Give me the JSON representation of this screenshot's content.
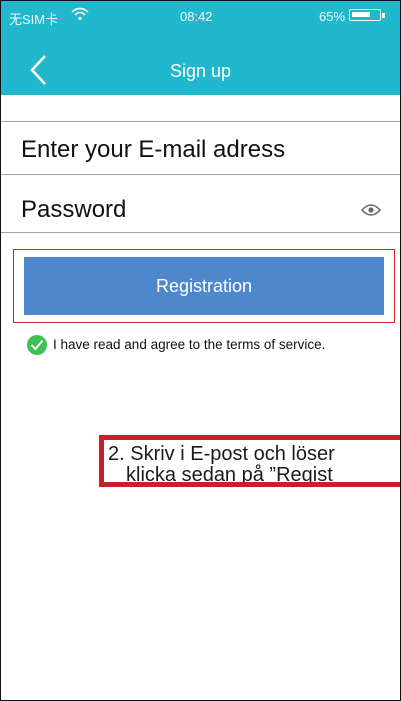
{
  "status_bar": {
    "carrier": "无SIM卡",
    "time": "08:42",
    "battery": "65%",
    "battery_level": 0.65
  },
  "header": {
    "back_icon": "chevron-left-icon",
    "title": "Sign up"
  },
  "form": {
    "email_placeholder": "Enter your E-mail adress",
    "password_placeholder": "Password",
    "eye_icon": "eye-icon"
  },
  "registration": {
    "button_label": "Registration"
  },
  "terms": {
    "checked": true,
    "check_icon": "check-icon",
    "text": "I have read and agree to the terms of service."
  },
  "annotation": {
    "line1": "2. Skriv i E-post och löser",
    "line2": "klicka sedan på ”Regist"
  },
  "colors": {
    "header": "#21b7cc",
    "button": "#4f87cc",
    "highlight": "#d8232a",
    "check": "#3fbf55"
  }
}
